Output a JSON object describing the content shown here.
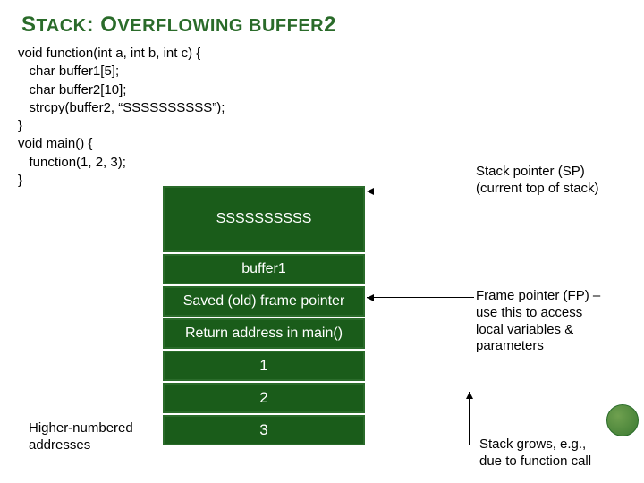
{
  "title_parts": {
    "p1": "S",
    "p2": "TACK",
    "p3": ": O",
    "p4": "VERFLOWING",
    "p5": " BUFFER",
    "p6": "2"
  },
  "code": {
    "l1": "void function(int a, int b, int c) {",
    "l2": "   char buffer1[5];",
    "l3": "   char buffer2[10];",
    "l4": "   strcpy(buffer2, “SSSSSSSSSS”);",
    "l5": "}",
    "l6": "",
    "l7": "void main() {",
    "l8": "   function(1, 2, 3);",
    "l9": "}"
  },
  "stack": {
    "buf2": "SSSSSSSSSS",
    "buf1": "buffer1",
    "sfp": "Saved (old) frame pointer",
    "ret": "Return address in main()",
    "p1": "1",
    "p2": "2",
    "p3": "3"
  },
  "annot": {
    "sp": "Stack pointer (SP)\n(current top of stack)",
    "fp": "Frame pointer (FP) –\nuse this to access\nlocal variables &\nparameters",
    "grow": "Stack grows, e.g.,\ndue to function call",
    "higher": "Higher-numbered\naddresses"
  }
}
